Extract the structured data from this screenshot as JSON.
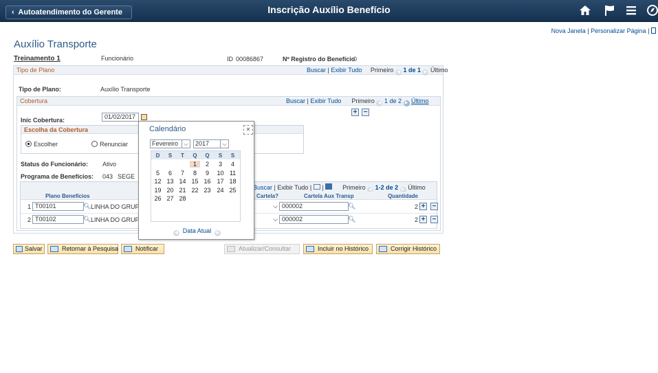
{
  "header": {
    "back_label": "Autoatendimento do Gerente",
    "title": "Inscrição Auxílio Benefício",
    "icons": [
      "home-icon",
      "flag-icon",
      "menu-icon",
      "navbar-icon"
    ]
  },
  "toplinks": {
    "new_window": "Nova Janela",
    "personalize": "Personalizar Página"
  },
  "component_title": "Auxílio Transporte",
  "employee": {
    "name": "Treinamento 1",
    "role": "Funcionário",
    "id_label": "ID",
    "id_value": "00086867",
    "benefit_reg_label": "Nº Registro do Benefício",
    "benefit_reg_value": "0"
  },
  "plan_type": {
    "title": "Tipo de Plano",
    "nav": {
      "search": "Buscar",
      "view_all": "Exibir Tudo",
      "first": "Primeiro",
      "count": "1 de 1",
      "last": "Último"
    },
    "label": "Tipo de Plano:",
    "value": "Auxílio Transporte"
  },
  "coverage": {
    "title": "Cobertura",
    "nav": {
      "search": "Buscar",
      "view_all": "Exibir Tudo",
      "first": "Primeiro",
      "count": "1 de 2",
      "last": "Último"
    },
    "start_label": "Iníc Cobertura:",
    "start_value": "01/02/2017",
    "choice_title": "Escolha da Cobertura",
    "choose_label": "Escolher",
    "waive_label": "Renunciar",
    "status_label": "Status do Funcionário:",
    "status_value": "Ativo",
    "program_label": "Programa de Benefícios:",
    "program_code": "043",
    "program_name": "SEGE"
  },
  "grid": {
    "nav": {
      "search": "Buscar",
      "view_all": "Exibir Tudo",
      "first": "Primeiro",
      "count": "1-2 de 2",
      "last": "Último"
    },
    "headers": {
      "plan": "Plano Benefícios",
      "card": "Cartela?",
      "card_aux": "Cartela Aux Transp",
      "qty": "Quantidade"
    },
    "rows": [
      {
        "num": "1",
        "plan": "T00101",
        "desc": "LINHA DO GRUPO",
        "card_aux": "000002",
        "qty": "2"
      },
      {
        "num": "2",
        "plan": "T00102",
        "desc": "LINHA DO GRUPO",
        "card_aux": "000002",
        "qty": "2"
      }
    ]
  },
  "calendar": {
    "title": "Calendário",
    "month": "Fevereiro",
    "year": "2017",
    "day_names": [
      "D",
      "S",
      "T",
      "Q",
      "Q",
      "S",
      "S"
    ],
    "weeks": [
      [
        "",
        "",
        "",
        "1",
        "2",
        "3",
        "4"
      ],
      [
        "5",
        "6",
        "7",
        "8",
        "9",
        "10",
        "11"
      ],
      [
        "12",
        "13",
        "14",
        "15",
        "16",
        "17",
        "18"
      ],
      [
        "19",
        "20",
        "21",
        "22",
        "23",
        "24",
        "25"
      ],
      [
        "26",
        "27",
        "28",
        "",
        "",
        "",
        ""
      ]
    ],
    "highlighted_day": "1",
    "footer": "Data Atual"
  },
  "buttons": {
    "save": "Salvar",
    "return_search": "Retornar à Pesquisa",
    "notify": "Notificar",
    "update_display": "Atualizar/Consultar",
    "include_history": "Incluir no Histórico",
    "correct_history": "Corrigir Histórico"
  },
  "colors": {
    "header_bg": "#1b3a5a",
    "section_title": "#b35c25",
    "link": "#004b91",
    "button_bg": "#f7e2a9"
  }
}
